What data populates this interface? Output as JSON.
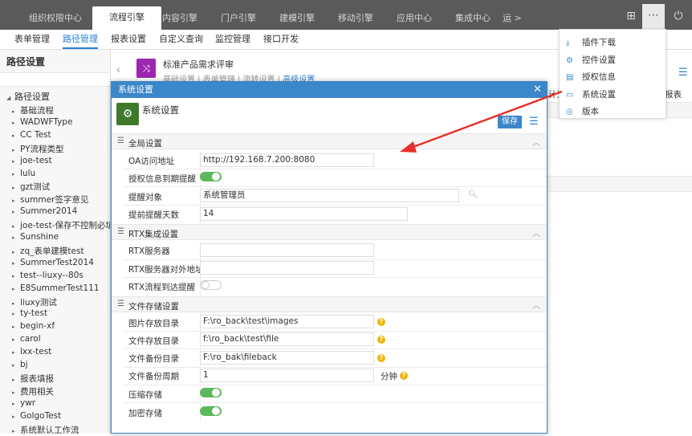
{
  "top_tabs": [
    "组织权限中心",
    "流程引擎",
    "内容引擎",
    "门户引擎",
    "建模引擎",
    "移动引擎",
    "应用中心",
    "集成中心",
    "运 >"
  ],
  "sub_nav": [
    "表单管理",
    "路径管理",
    "报表设置",
    "自定义查询",
    "监控管理",
    "接口开发"
  ],
  "sidebar": {
    "title": "路径设置",
    "root": "路径设置",
    "items": [
      "基础流程",
      "WADWFType",
      "CC Test",
      "PY流程类型",
      "joe-test",
      "lulu",
      "gzt测试",
      "summer签字意见",
      "Summer2014",
      "joe-test-保存不控制必填",
      "Sunshine",
      "zq_表单建模test",
      "SummerTest2014",
      "test--liuxy--80s",
      "E8SummerTest111",
      "liuxy测试",
      "ty-test",
      "begin-xf",
      "carol",
      "lxx-test",
      "bj",
      "报表填报",
      "费用相关",
      "ywr",
      "GolgoTest",
      "系统默认工作流"
    ]
  },
  "workflow": {
    "title": "标准产品需求评审",
    "tabs": [
      "基础设置",
      "表单管理",
      "流转设置",
      "高级设置"
    ],
    "right_labels": [
      "计划",
      "报表"
    ]
  },
  "dialog": {
    "header": "系统设置",
    "title": "系统设置",
    "save": "保存",
    "sections": {
      "global": {
        "label": "全局设置",
        "oa_url_label": "OA访问地址",
        "oa_url_value": "http://192.168.7.200:8080",
        "expire_label": "授权信息到期提醒",
        "remind_obj_label": "提醒对象",
        "remind_obj_value": "系统管理员",
        "remind_days_label": "提前提醒天数",
        "remind_days_value": "14"
      },
      "rtx": {
        "label": "RTX集成设置",
        "server_label": "RTX服务器",
        "external_label": "RTX服务器对外地址",
        "flow_label": "RTX流程到达提醒"
      },
      "storage": {
        "label": "文件存储设置",
        "image_label": "图片存放目录",
        "image_value": "F:\\ro_back\\test\\images",
        "file_label": "文件存放目录",
        "file_value": "f:\\ro_back\\test\\file",
        "backup_label": "文件备份目录",
        "backup_value": "F:\\ro_bak\\fileback",
        "period_label": "文件备份周期",
        "period_value": "1",
        "period_unit": "分钟",
        "compress_label": "压缩存储",
        "encrypt_label": "加密存储"
      }
    }
  },
  "menu": {
    "items": [
      "插件下载",
      "控件设置",
      "授权信息",
      "系统设置",
      "版本"
    ]
  },
  "colors": {
    "topbar": "#5a5a5a",
    "accent": "#3a87c9",
    "toggle_on": "#5cb85c",
    "arrow": "#e8312a"
  }
}
